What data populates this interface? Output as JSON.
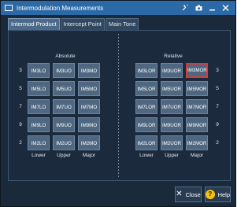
{
  "window": {
    "title": "Intermodulation Measurements"
  },
  "titlebar_icons": [
    "wrench-icon",
    "camera-icon",
    "minimize-icon",
    "close-icon"
  ],
  "tabs": [
    {
      "label": "Intermod Product",
      "active": true
    },
    {
      "label": "Intercept Point",
      "active": false
    },
    {
      "label": "Main Tone",
      "active": false
    }
  ],
  "absolute": {
    "title": "Absolute",
    "row_labels": [
      "3",
      "5",
      "7",
      "9",
      "2"
    ],
    "rows": [
      [
        "IM3LO",
        "IM3UO",
        "IM3MO"
      ],
      [
        "IM5LO",
        "IM5UO",
        "IM5MO"
      ],
      [
        "IM7LO",
        "IM7UO",
        "IM7MO"
      ],
      [
        "IM9LO",
        "IM9UO",
        "IM9MO"
      ],
      [
        "IM2LO",
        "IM2UO",
        "IM2MO"
      ]
    ],
    "col_labels": [
      "Lower",
      "Upper",
      "Major"
    ]
  },
  "relative": {
    "title": "Relative",
    "row_labels": [
      "3",
      "5",
      "7",
      "9",
      "2"
    ],
    "rows": [
      [
        "IM3LOR",
        "IM3UOR",
        "IM3MOR"
      ],
      [
        "IM5LOR",
        "IM5UOR",
        "IM5MOR"
      ],
      [
        "IM7LOR",
        "IM7UOR",
        "IM7MOR"
      ],
      [
        "IM9LOR",
        "IM9UOR",
        "IM9MOR"
      ],
      [
        "IM2LOR",
        "IM2UOR",
        "IM2MOR"
      ]
    ],
    "col_labels": [
      "Lower",
      "Upper",
      "Major"
    ],
    "selected": "IM3MOR"
  },
  "footer": {
    "close_label": "Close",
    "help_label": "Help",
    "help_symbol": "?"
  }
}
